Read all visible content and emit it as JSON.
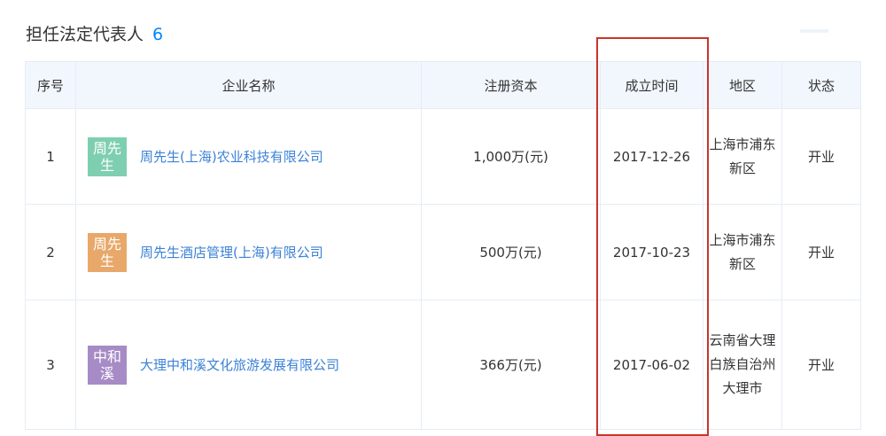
{
  "section": {
    "title": "担任法定代表人",
    "count": "6"
  },
  "colors": {
    "accent": "#0084ff",
    "link": "#3c82d6",
    "open_status": "#4caf50",
    "highlight": "#c9342b"
  },
  "table": {
    "headers": {
      "index": "序号",
      "company": "企业名称",
      "capital": "注册资本",
      "founded": "成立时间",
      "region": "地区",
      "status": "状态"
    },
    "rows": [
      {
        "index": "1",
        "logo_text": "周先生",
        "logo_color": "#7ecfb0",
        "company": "周先生(上海)农业科技有限公司",
        "capital": "1,000万(元)",
        "founded": "2017-12-26",
        "region": "上海市浦东新区",
        "status": "开业"
      },
      {
        "index": "2",
        "logo_text": "周先生",
        "logo_color": "#e8a86a",
        "company": "周先生酒店管理(上海)有限公司",
        "capital": "500万(元)",
        "founded": "2017-10-23",
        "region": "上海市浦东新区",
        "status": "开业"
      },
      {
        "index": "3",
        "logo_text": "中和溪",
        "logo_color": "#a68bc6",
        "company": "大理中和溪文化旅游发展有限公司",
        "capital": "366万(元)",
        "founded": "2017-06-02",
        "region": "云南省大理白族自治州大理市",
        "status": "开业"
      }
    ]
  }
}
